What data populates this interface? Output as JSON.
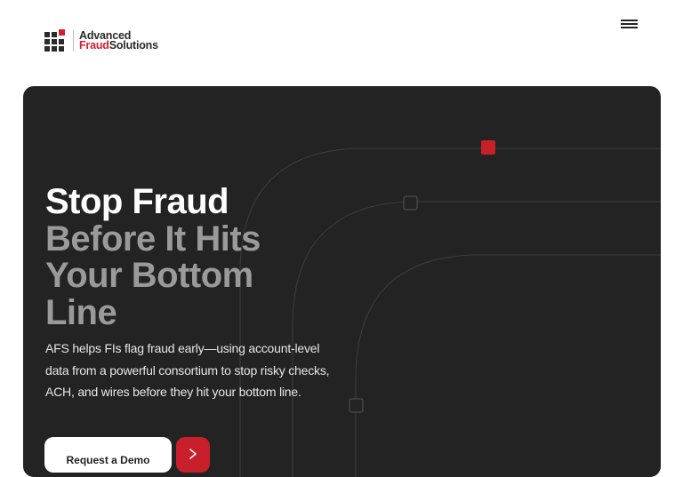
{
  "brand": {
    "name_line1": "Advanced",
    "name_fraud": "Fraud",
    "name_solutions": "Solutions",
    "accent_color": "#d2202f"
  },
  "header": {
    "menu_icon": "hamburger-menu-icon"
  },
  "hero": {
    "title_line1": "Stop Fraud",
    "title_line2": "Before It Hits",
    "title_line3": "Your Bottom",
    "title_line4": "Line",
    "description": "AFS helps FIs flag fraud early—using account-level data from a powerful consortium to stop risky checks, ACH, and wires before they hit your bottom line.",
    "cta_label": "Request a Demo",
    "arrow_icon": "arrow-right-icon",
    "background_color": "#232323",
    "arrow_button_color": "#c8202a"
  }
}
